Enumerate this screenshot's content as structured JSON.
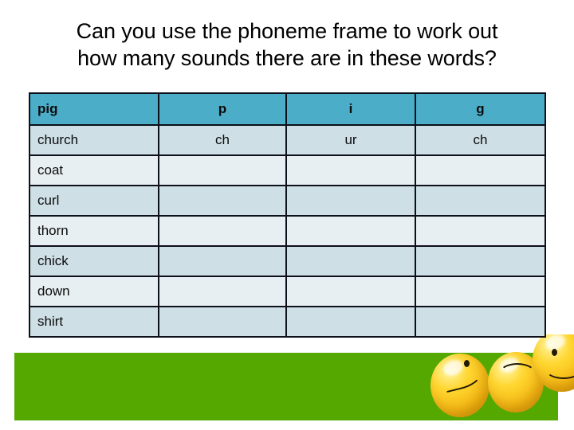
{
  "slide": {
    "title_line_1": "Can you use the phoneme frame to work out",
    "title_line_2": "how many sounds there are in these words?",
    "colors": {
      "header_teal": "#4badc8",
      "row_light": "#e8eff2",
      "row_dark": "#cedfe6",
      "band_green": "#54a800",
      "border": "#0d0f1a",
      "text": "#0b0b0b"
    }
  },
  "table": {
    "header": {
      "word": "pig",
      "sound_1": "p",
      "sound_2": "i",
      "sound_3": "g"
    },
    "rows": [
      {
        "word": "church",
        "sound_1": "ch",
        "sound_2": "ur",
        "sound_3": "ch"
      },
      {
        "word": "coat",
        "sound_1": "",
        "sound_2": "",
        "sound_3": ""
      },
      {
        "word": "curl",
        "sound_1": "",
        "sound_2": "",
        "sound_3": ""
      },
      {
        "word": "thorn",
        "sound_1": "",
        "sound_2": "",
        "sound_3": ""
      },
      {
        "word": "chick",
        "sound_1": "",
        "sound_2": "",
        "sound_3": ""
      },
      {
        "word": "down",
        "sound_1": "",
        "sound_2": "",
        "sound_3": ""
      },
      {
        "word": "shirt",
        "sound_1": "",
        "sound_2": "",
        "sound_3": ""
      }
    ]
  },
  "decoration": {
    "balls": [
      {
        "name": "smiley-ball-left"
      },
      {
        "name": "smiley-ball-middle"
      },
      {
        "name": "smiley-ball-right"
      }
    ]
  }
}
